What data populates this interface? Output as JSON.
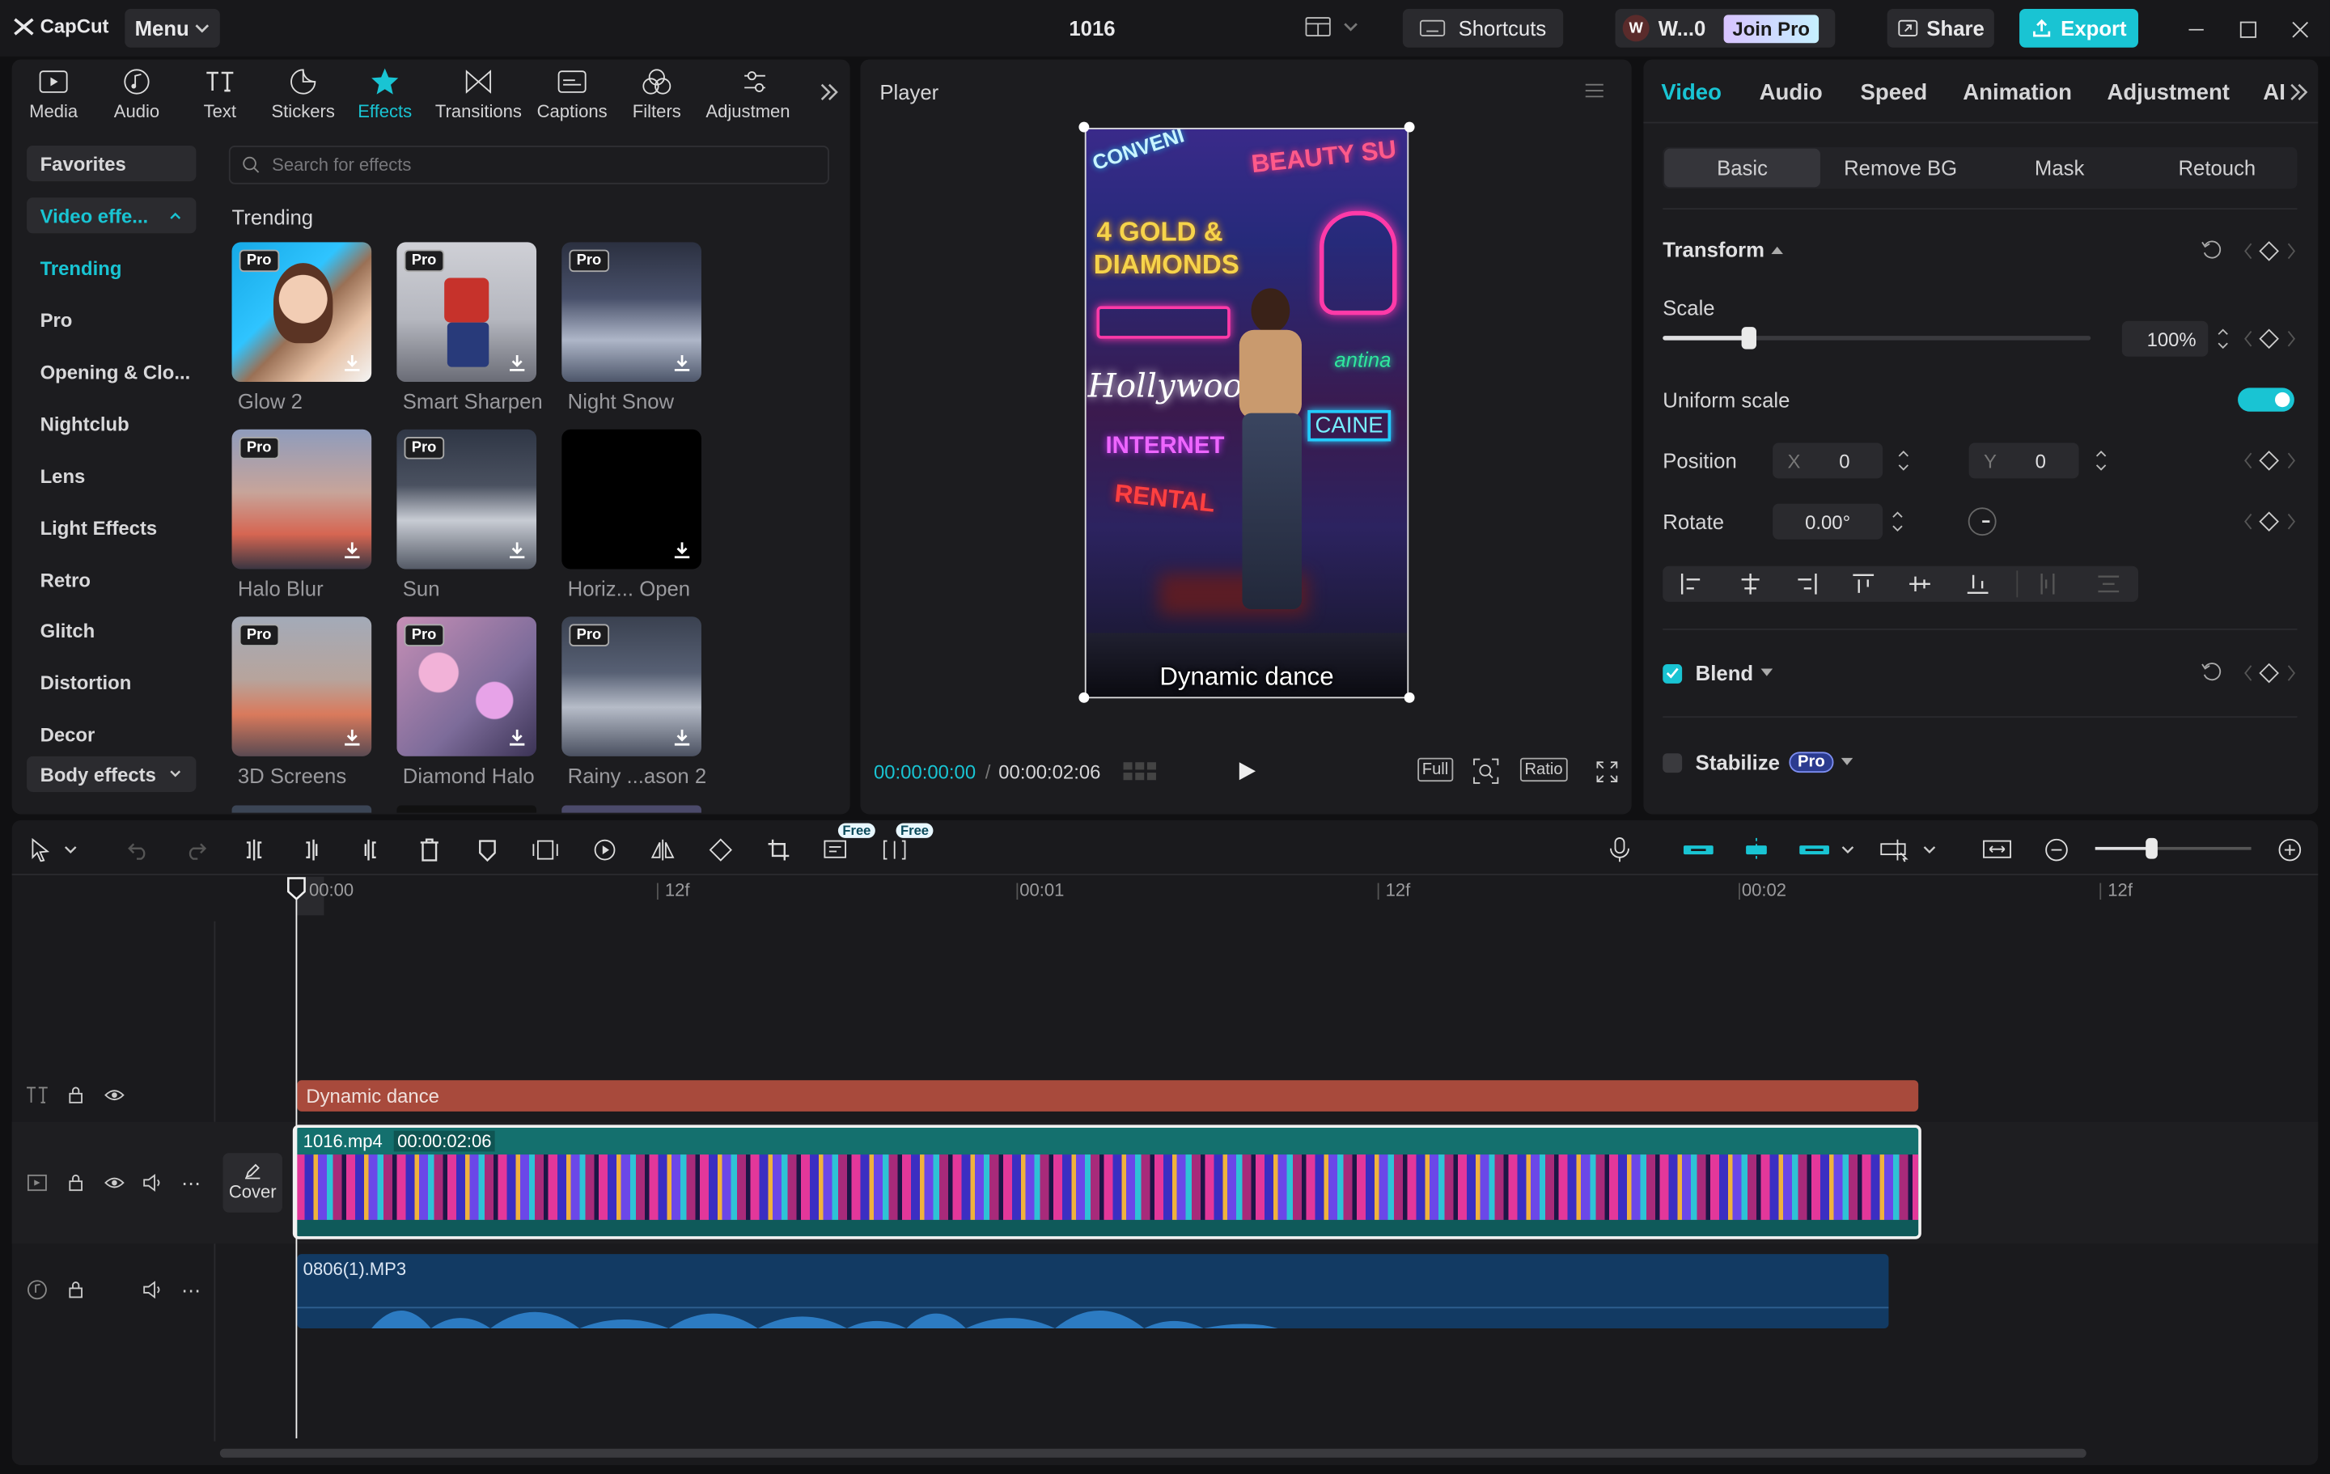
{
  "app": {
    "logo": "CapCut",
    "menu_label": "Menu",
    "project_title": "1016"
  },
  "topbar": {
    "shortcuts_label": "Shortcuts",
    "workspace_label": "W...0",
    "workspace_avatar": "W",
    "join_pro_label": "Join Pro",
    "share_label": "Share",
    "export_label": "Export"
  },
  "toolbar": {
    "items": [
      {
        "label": "Media",
        "icon": "media-icon"
      },
      {
        "label": "Audio",
        "icon": "audio-icon"
      },
      {
        "label": "Text",
        "icon": "text-icon"
      },
      {
        "label": "Stickers",
        "icon": "stickers-icon"
      },
      {
        "label": "Effects",
        "icon": "effects-icon"
      },
      {
        "label": "Transitions",
        "icon": "transitions-icon"
      },
      {
        "label": "Captions",
        "icon": "captions-icon"
      },
      {
        "label": "Filters",
        "icon": "filters-icon"
      },
      {
        "label": "Adjustmen",
        "icon": "adjustment-icon"
      }
    ],
    "active": "Effects"
  },
  "sidebar": {
    "favorites": "Favorites",
    "video_effects": "Video effe...",
    "items": [
      "Trending",
      "Pro",
      "Opening & Clo...",
      "Nightclub",
      "Lens",
      "Light Effects",
      "Retro",
      "Glitch",
      "Distortion",
      "Decor"
    ],
    "body_effects": "Body effects"
  },
  "effects": {
    "search_placeholder": "Search for effects",
    "section_title": "Trending",
    "pro_badge": "Pro",
    "items": [
      {
        "label": "Glow 2",
        "pro": true
      },
      {
        "label": "Smart Sharpen",
        "pro": true
      },
      {
        "label": "Night Snow",
        "pro": true
      },
      {
        "label": "Halo Blur",
        "pro": true
      },
      {
        "label": "Sun",
        "pro": true
      },
      {
        "label": "Horiz... Open",
        "pro": false
      },
      {
        "label": "3D Screens",
        "pro": true
      },
      {
        "label": "Diamond Halo",
        "pro": true
      },
      {
        "label": "Rainy ...ason 2",
        "pro": true
      }
    ]
  },
  "player": {
    "title": "Player",
    "caption": "Dynamic dance",
    "neon_signs": [
      "CONVENI",
      "BEAUTY SU",
      "4 GOLD &",
      "DIAMONDS",
      "Hollywood",
      "INTERNET",
      "RENTAL",
      "antina",
      "CAINE"
    ],
    "current_time": "00:00:00:00",
    "total_time": "00:00:02:06",
    "buttons": {
      "full": "Full",
      "ratio": "Ratio"
    }
  },
  "inspector": {
    "tabs": [
      "Video",
      "Audio",
      "Speed",
      "Animation",
      "Adjustment",
      "AI"
    ],
    "active_tab": "Video",
    "subtabs": [
      "Basic",
      "Remove BG",
      "Mask",
      "Retouch"
    ],
    "active_subtab": "Basic",
    "transform_label": "Transform",
    "scale_label": "Scale",
    "scale_value": "100%",
    "scale_fraction": 0.2,
    "uniform_scale_label": "Uniform scale",
    "uniform_scale_on": true,
    "position_label": "Position",
    "pos_x_label": "X",
    "pos_x_value": "0",
    "pos_y_label": "Y",
    "pos_y_value": "0",
    "rotate_label": "Rotate",
    "rotate_value": "0.00°",
    "blend_label": "Blend",
    "blend_checked": true,
    "stabilize_label": "Stabilize",
    "stabilize_badge": "Pro"
  },
  "timeline": {
    "free_badge": "Free",
    "ruler": [
      "00:00",
      "12f",
      "00:01",
      "12f",
      "00:02",
      "12f"
    ],
    "text_clip": "Dynamic dance",
    "video_clip_name": "1016.mp4",
    "video_clip_duration": "00:00:02:06",
    "cover_label": "Cover",
    "audio_clip": "0806(1).MP3",
    "zoom_fraction": 0.36
  },
  "colors": {
    "accent": "#18c5d3",
    "text_clip": "#a84a3c",
    "video_clip": "#14706e",
    "audio_clip": "#123a63",
    "panel": "#1c1c1f"
  }
}
